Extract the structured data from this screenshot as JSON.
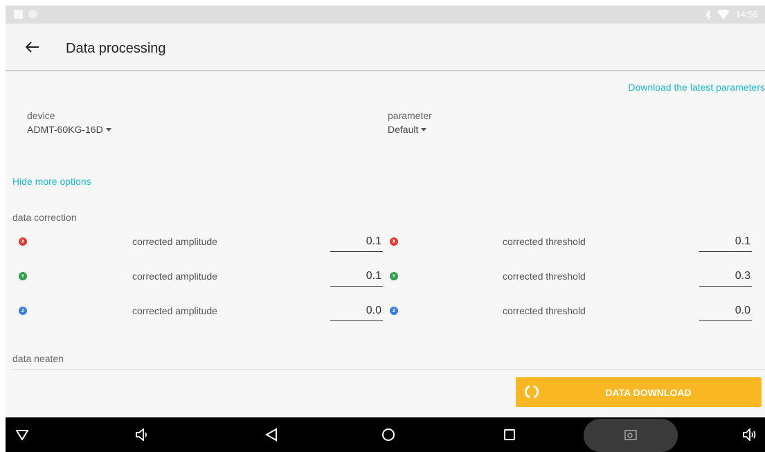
{
  "status_bar": {
    "time": "14:56"
  },
  "app_bar": {
    "title": "Data processing"
  },
  "content": {
    "download_params_link": "Download the latest parameters",
    "device": {
      "label": "device",
      "value": "ADMT-60KG-16D"
    },
    "parameter": {
      "label": "parameter",
      "value": "Default"
    },
    "hide_options_link": "Hide more options",
    "data_correction_label": "data correction",
    "rows": [
      {
        "axis": "X",
        "color": "#e03c31",
        "amp_label": "corrected amplitude",
        "amp_value": "0.1",
        "thr_label": "corrected threshold",
        "thr_value": "0.1"
      },
      {
        "axis": "Y",
        "color": "#2e9e4a",
        "amp_label": "corrected amplitude",
        "amp_value": "0.1",
        "thr_label": "corrected threshold",
        "thr_value": "0.3"
      },
      {
        "axis": "Z",
        "color": "#3a7fdd",
        "amp_label": "corrected amplitude",
        "amp_value": "0.0",
        "thr_label": "corrected threshold",
        "thr_value": "0.0"
      }
    ],
    "data_neaten_label": "data neaten",
    "download_button": "DATA DOWNLOAD"
  },
  "nav_bar": {
    "icons": [
      "dropdown-triangle-icon",
      "volume-down-icon",
      "back-icon",
      "home-icon",
      "recents-icon",
      "screenshot-icon",
      "volume-up-icon"
    ]
  },
  "colors": {
    "accent_link": "#1fb5c8",
    "button": "#f9b823"
  }
}
